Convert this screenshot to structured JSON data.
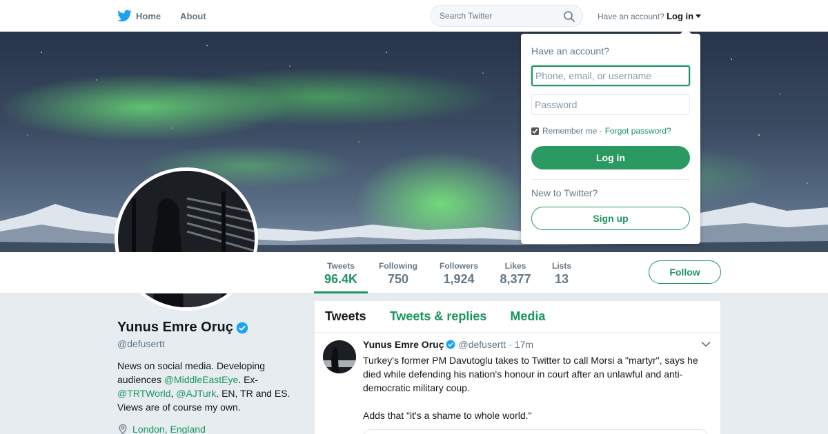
{
  "nav": {
    "home_label": "Home",
    "about_label": "About",
    "search_placeholder": "Search Twitter",
    "account_prompt": "Have an account?",
    "login_label": "Log in"
  },
  "profile": {
    "name": "Yunus Emre Oruç",
    "handle": "@defusertt",
    "bio": {
      "part1": "News on social media. Developing audiences ",
      "link1": "@MiddleEastEye",
      "part2": ". Ex-",
      "link2": "@TRTWorld",
      "part3": ", ",
      "link3": "@AJTurk",
      "part4": ". EN, TR and ES. Views are of course my own."
    },
    "location": "London, England"
  },
  "stats": [
    {
      "label": "Tweets",
      "value": "96.4K"
    },
    {
      "label": "Following",
      "value": "750"
    },
    {
      "label": "Followers",
      "value": "1,924"
    },
    {
      "label": "Likes",
      "value": "8,377"
    },
    {
      "label": "Lists",
      "value": "13"
    }
  ],
  "follow_label": "Follow",
  "timeline": {
    "tabs": [
      "Tweets",
      "Tweets & replies",
      "Media"
    ],
    "tweet": {
      "name": "Yunus Emre Oruç",
      "handle": "@defusertt",
      "separator": "·",
      "time": "17m",
      "text": "Turkey's former PM Davutoglu takes to Twitter to call Morsi a \"martyr\", says he died while defending his nation's honour in court after an unlawful and anti-democratic military coup.",
      "text2": "Adds that \"it's a shame to whole world.\""
    }
  },
  "login_dropdown": {
    "title": "Have an account?",
    "username_placeholder": "Phone, email, or username",
    "password_placeholder": "Password",
    "remember_label": "Remember me ·",
    "remember_checked": true,
    "forgot_label": "Forgot password?",
    "login_button": "Log in",
    "new_prompt": "New to Twitter?",
    "signup_button": "Sign up"
  },
  "colors": {
    "accent": "#1b9561",
    "login_button_bg": "#2b9a62",
    "verified": "#1da1f2",
    "twitter_blue": "#1da1f2"
  }
}
